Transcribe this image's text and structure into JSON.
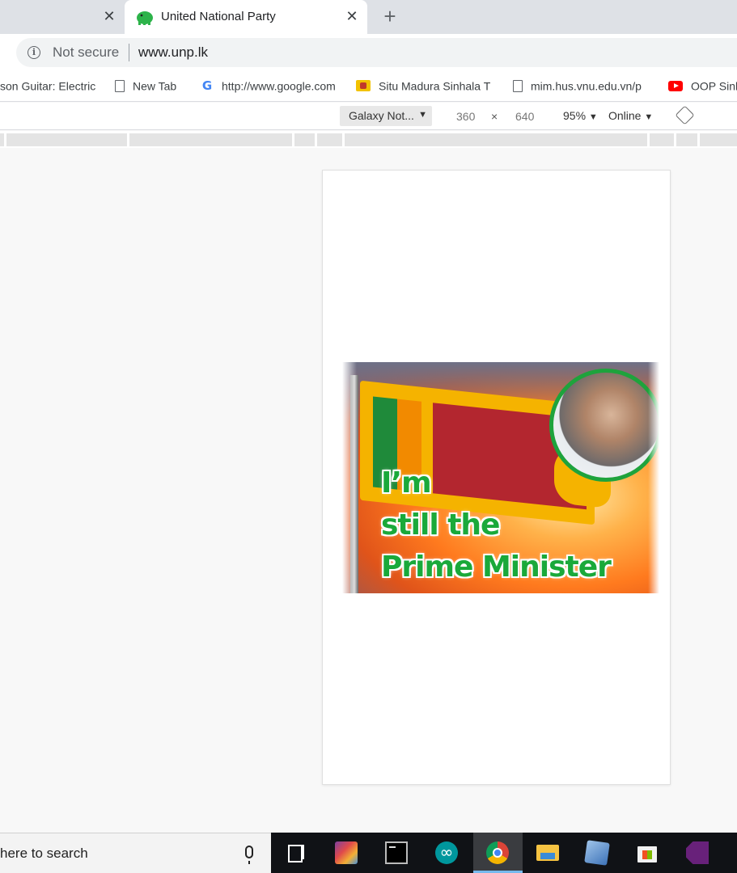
{
  "browser": {
    "tabs": [
      {
        "label": ""
      },
      {
        "label": "United National Party",
        "active": true
      }
    ],
    "close_glyph": "✕",
    "new_tab_glyph": "+",
    "address": {
      "security_label": "Not secure",
      "url": "www.unp.lk"
    },
    "bookmarks": [
      {
        "label": "son Guitar: Electric",
        "icon": "page-icon"
      },
      {
        "label": "New Tab",
        "icon": "doc-icon"
      },
      {
        "label": "http://www.google.com",
        "icon": "google-icon"
      },
      {
        "label": "Situ Madura Sinhala T",
        "icon": "lion-flag-icon"
      },
      {
        "label": "mim.hus.vnu.edu.vn/p",
        "icon": "doc-icon"
      },
      {
        "label": "OOP Sinh",
        "icon": "youtube-icon"
      }
    ]
  },
  "devtools": {
    "device": "Galaxy Not...",
    "width": "360",
    "times": "×",
    "height": "640",
    "zoom": "95%",
    "throttle": "Online",
    "dropdown_glyph": "▼"
  },
  "page": {
    "headline": [
      "I’m",
      "still the",
      "Prime Minister"
    ]
  },
  "taskbar": {
    "search_placeholder": "here to search",
    "apps": [
      "task-view",
      "winrar",
      "command-prompt",
      "arduino",
      "chrome",
      "file-explorer",
      "virtualbox",
      "microsoft-store",
      "visual-studio"
    ]
  },
  "colors": {
    "tab_strip": "#dee1e6",
    "headline_green": "#1aa93a",
    "taskbar": "#101216",
    "taskbar_active_indicator": "#76b9ed"
  }
}
